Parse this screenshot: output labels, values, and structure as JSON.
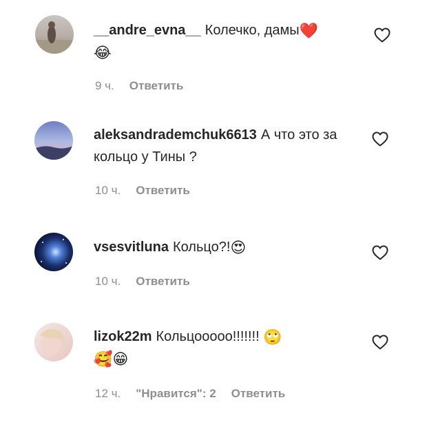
{
  "comments": [
    {
      "username": "__andre_evna__",
      "text": "Колечко, дамы",
      "emoji_inline": "❤️",
      "emoji_second_line": "😂",
      "time": "9 ч.",
      "reply_label": "Ответить"
    },
    {
      "username": "aleksandrademchuk6613",
      "text": "А что это за кольцо у Тины ?",
      "time": "10 ч.",
      "reply_label": "Ответить"
    },
    {
      "username": "vsesvitluna",
      "text": "Кольцо?!",
      "emoji_inline": "😍",
      "time": "10 ч.",
      "reply_label": "Ответить"
    },
    {
      "username": "lizok22m",
      "text": "Кольцооооо!!!!!!!",
      "emoji_inline": "🙄",
      "emoji_second_line": "🥰😁",
      "time": "12 ч.",
      "likes_label": "\"Нравится\": 2",
      "reply_label": "Ответить"
    }
  ],
  "icons": {
    "like": "heart-outline-icon",
    "avatar": "avatar-photo"
  },
  "colors": {
    "text": "#262626",
    "meta": "#8e8e8e",
    "like_icon": "#262626"
  }
}
